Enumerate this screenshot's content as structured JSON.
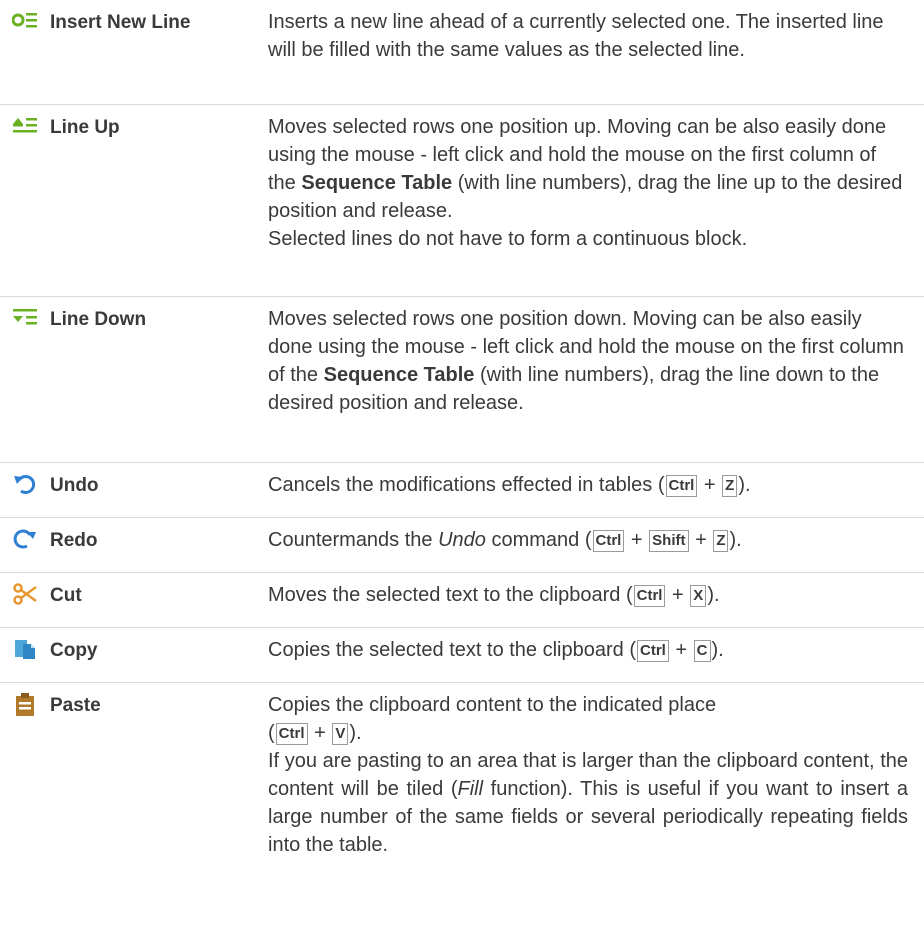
{
  "rows": [
    {
      "icon": "insert-new-line-icon",
      "name": "Insert New Line",
      "description": "Inserts a new line ahead of a currently selected one. The inserted line will be filled with the same values as the selected line."
    },
    {
      "icon": "line-up-icon",
      "name": "Line Up",
      "description_part1": "Moves selected rows one position up. Moving can be also easily done using the mouse - left click and hold the mouse on the first column of the ",
      "description_bold": "Sequence Table",
      "description_part2": " (with line numbers), drag the line up to the desired position and release.",
      "description_note": "Selected lines do not have to form a continuous block."
    },
    {
      "icon": "line-down-icon",
      "name": "Line Down",
      "description_part1": "Moves selected rows one position down. Moving can be also easily done using the mouse - left click and hold the mouse on the first column of the ",
      "description_bold": "Sequence Table",
      "description_part2": " (with line numbers), drag the line down to the desired position and release."
    },
    {
      "icon": "undo-icon",
      "name": "Undo",
      "description_part1": "Cancels the modifications effected in tables (",
      "keys": [
        "Ctrl",
        "Z"
      ],
      "description_part2": ")."
    },
    {
      "icon": "redo-icon",
      "name": "Redo",
      "description_part1": "Countermands the ",
      "description_italic": "Undo",
      "description_part2": " command (",
      "keys": [
        "Ctrl",
        "Shift",
        "Z"
      ],
      "description_part3": ")."
    },
    {
      "icon": "scissors-icon",
      "name": "Cut",
      "description_part1": "Moves the selected text to the clipboard (",
      "keys": [
        "Ctrl",
        "X"
      ],
      "description_part2": ")."
    },
    {
      "icon": "copy-icon",
      "name": "Copy",
      "description_part1": "Copies the selected text to the clipboard (",
      "keys": [
        "Ctrl",
        "C"
      ],
      "description_part2": ")."
    },
    {
      "icon": "clipboard-icon",
      "name": "Paste",
      "description_part1": "Copies the clipboard content to the indicated place",
      "description_part2": "(",
      "keys": [
        "Ctrl",
        "V"
      ],
      "description_part3": ").",
      "description_para2_part1": "If you are pasting to an area that is larger than the clipboard content, the content will be tiled (",
      "description_para2_italic": "Fill",
      "description_para2_part2": " function). This is useful if you want to insert a large number of the same fields or several periodically repeating fields into the table."
    }
  ],
  "key_separator": "+",
  "colors": {
    "text": "#3a3a3a",
    "green_icon": "#6ab023",
    "blue_icon": "#2f7fd3",
    "orange_icon": "#e8972f",
    "copy_icon": "#4ea5da",
    "paste_icon": "#b07a2a",
    "divider": "#d9d9d9"
  }
}
